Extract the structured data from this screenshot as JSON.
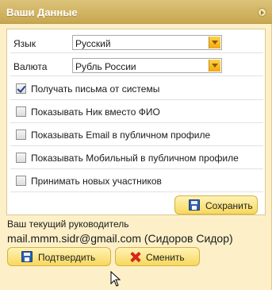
{
  "panel": {
    "title": "Ваши Данные"
  },
  "settings": {
    "language": {
      "label": "Язык",
      "value": "Русский"
    },
    "currency": {
      "label": "Валюта",
      "value": "Рубль России"
    },
    "options": [
      {
        "label": "Получать письма от системы",
        "checked": true
      },
      {
        "label": "Показывать Ник вместо ФИО",
        "checked": false
      },
      {
        "label": "Показывать Email в публичном профиле",
        "checked": false
      },
      {
        "label": "Показывать Мобильный в публичном профиле",
        "checked": false
      },
      {
        "label": "Принимать новых участников",
        "checked": false
      }
    ],
    "save_label": "Сохранить"
  },
  "supervisor": {
    "heading": "Ваш текущий руководитель",
    "value": "mail.mmm.sidr@gmail.com (Сидоров Сидор)",
    "confirm_label": "Подтвердить",
    "change_label": "Сменить"
  },
  "colors": {
    "titlebar": "#c7a750",
    "panel_bg": "#fdf0c8",
    "button": "#f7d85d",
    "accent_select": "#f3a90f"
  }
}
